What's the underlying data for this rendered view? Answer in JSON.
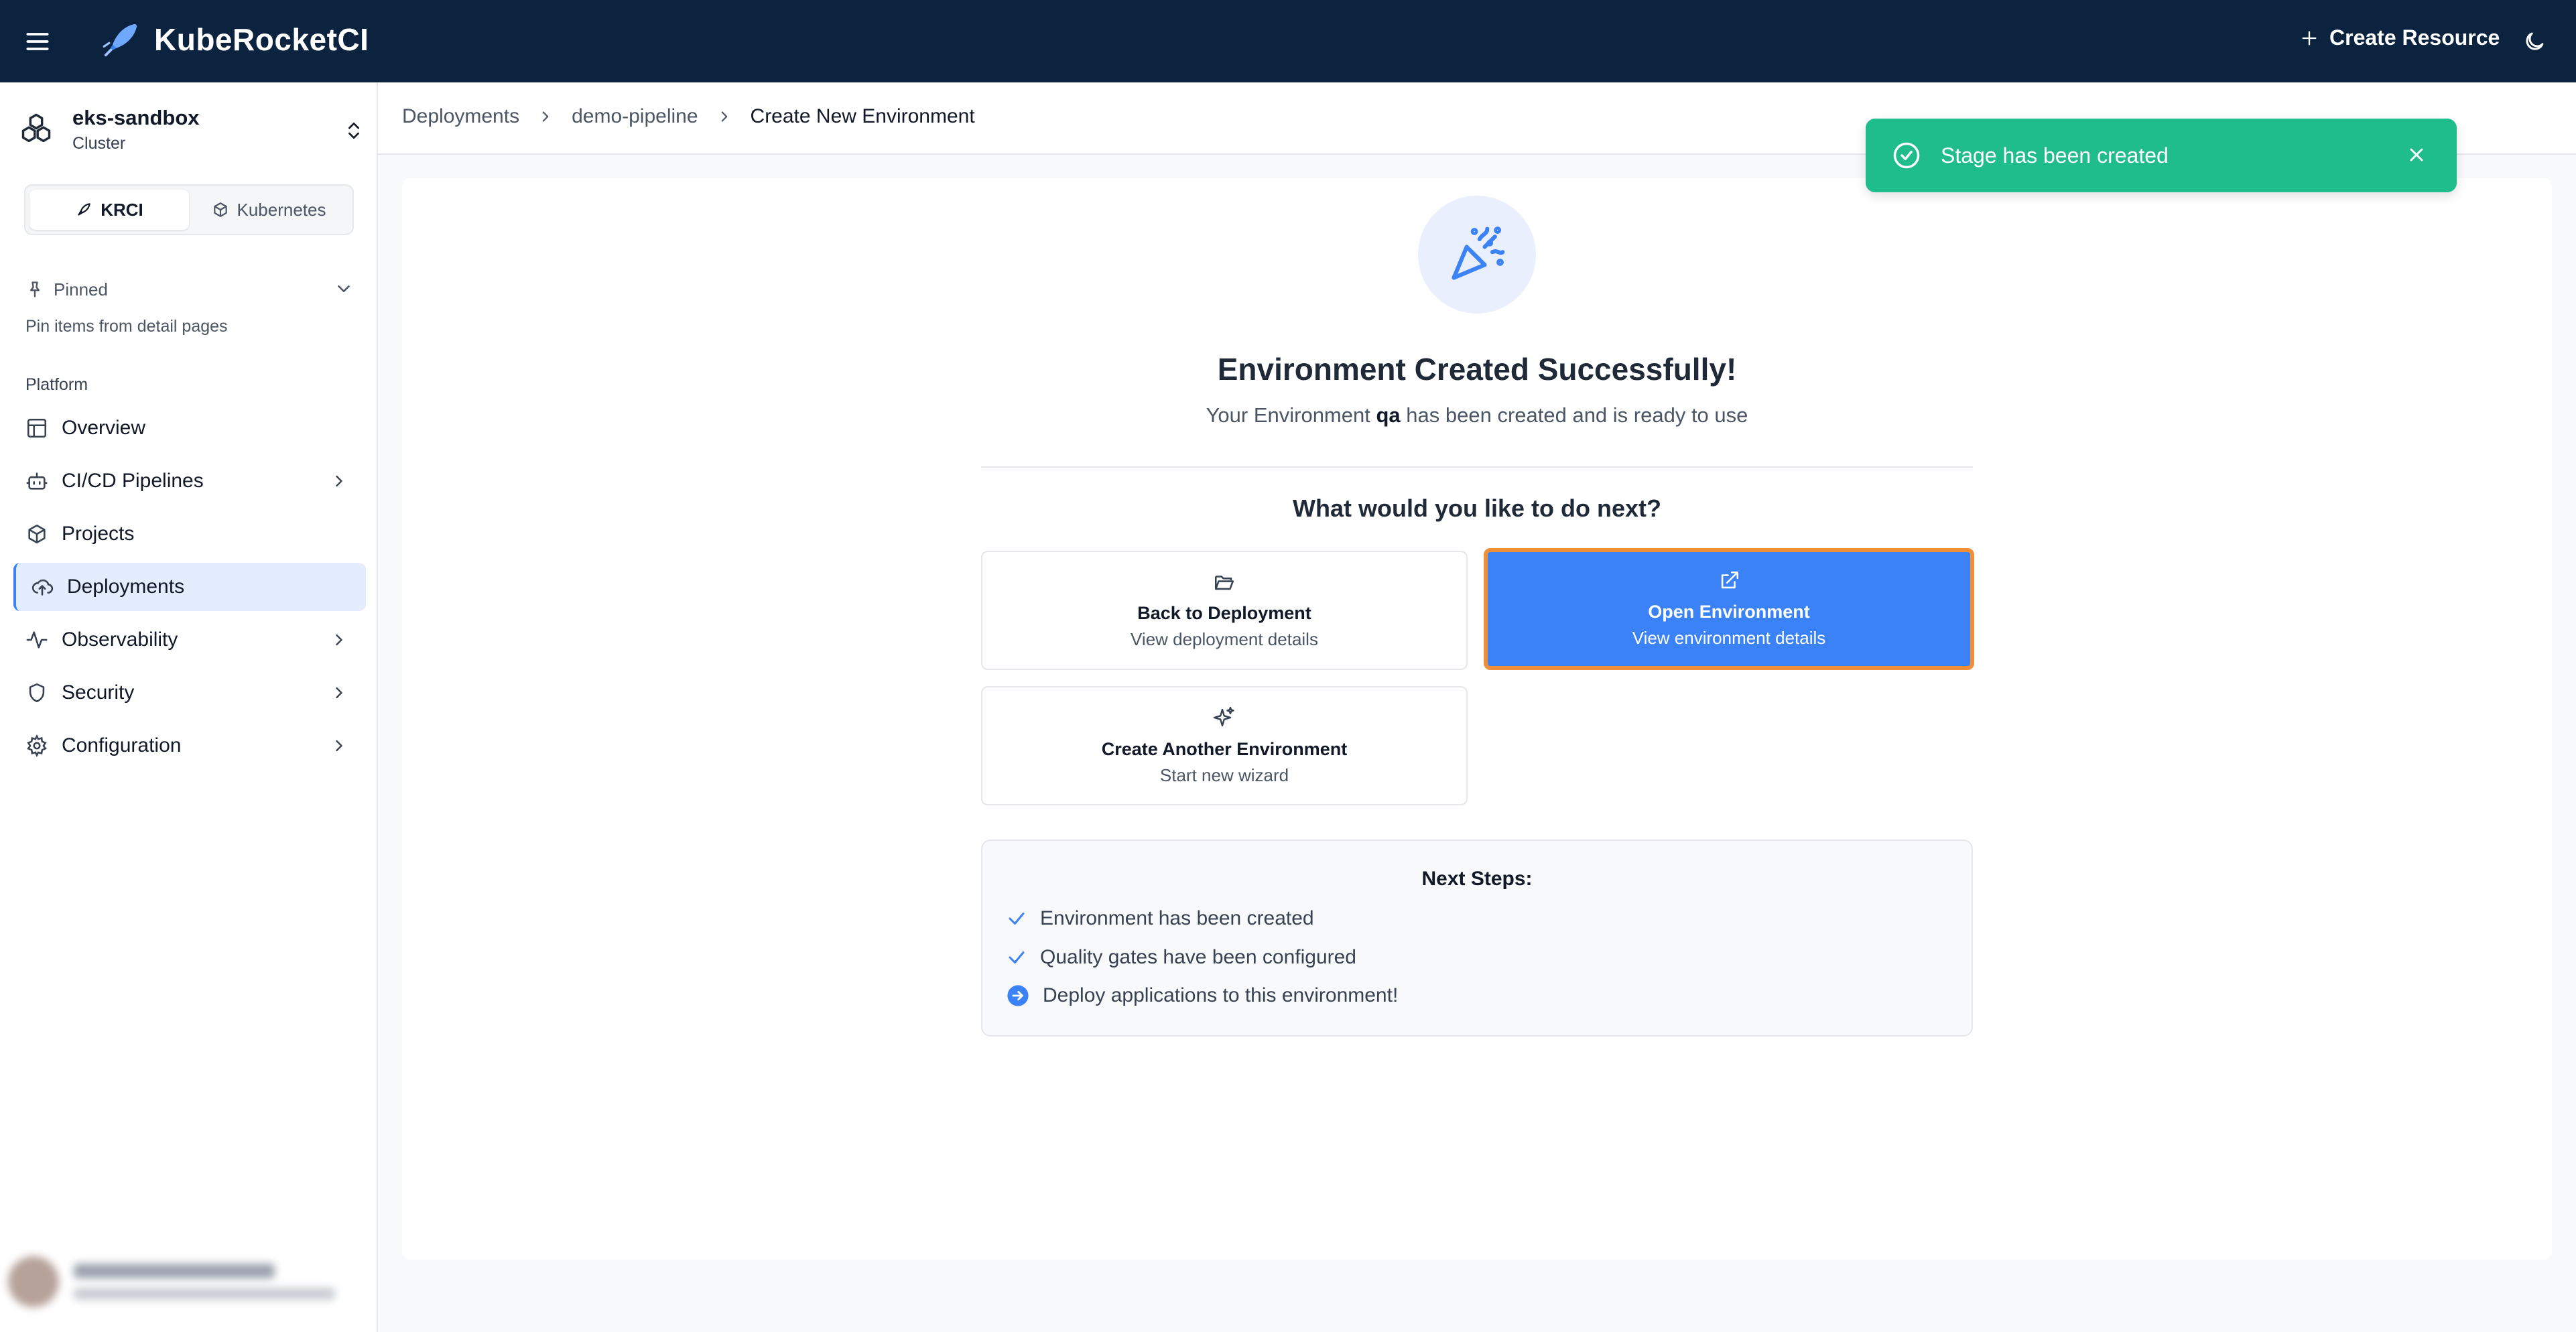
{
  "app": {
    "brand": "KubeRocketCI",
    "create_resource": "Create Resource"
  },
  "sidebar": {
    "cluster_name": "eks-sandbox",
    "cluster_type": "Cluster",
    "tabs": [
      {
        "label": "KRCI",
        "active": true
      },
      {
        "label": "Kubernetes",
        "active": false
      }
    ],
    "pinned_label": "Pinned",
    "pinned_hint": "Pin items from detail pages",
    "section_label": "Platform",
    "items": [
      {
        "label": "Overview",
        "icon": "overview-icon",
        "has_children": false,
        "active": false
      },
      {
        "label": "CI/CD Pipelines",
        "icon": "bot-icon",
        "has_children": true,
        "active": false
      },
      {
        "label": "Projects",
        "icon": "box-icon",
        "has_children": false,
        "active": false
      },
      {
        "label": "Deployments",
        "icon": "cloud-upload-icon",
        "has_children": false,
        "active": true
      },
      {
        "label": "Observability",
        "icon": "activity-icon",
        "has_children": true,
        "active": false
      },
      {
        "label": "Security",
        "icon": "shield-icon",
        "has_children": true,
        "active": false
      },
      {
        "label": "Configuration",
        "icon": "gear-icon",
        "has_children": true,
        "active": false
      }
    ]
  },
  "breadcrumbs": [
    "Deployments",
    "demo-pipeline",
    "Create New Environment"
  ],
  "toast": {
    "message": "Stage has been created",
    "color": "#1fbd8a"
  },
  "success": {
    "title": "Environment Created Successfully!",
    "subtitle_prefix": "Your Environment ",
    "env_name": "qa",
    "subtitle_suffix": " has been created and is ready to use",
    "next_question": "What would you like to do next?"
  },
  "actions": {
    "back": {
      "label": "Back to Deployment",
      "desc": "View deployment details"
    },
    "open": {
      "label": "Open Environment",
      "desc": "View environment details"
    },
    "another": {
      "label": "Create Another Environment",
      "desc": "Start new wizard"
    }
  },
  "next_steps": {
    "title": "Next Steps:",
    "items": [
      {
        "text": "Environment has been created",
        "status": "done"
      },
      {
        "text": "Quality gates have been configured",
        "status": "done"
      },
      {
        "text": "Deploy applications to this environment!",
        "status": "next"
      }
    ]
  },
  "colors": {
    "header_bg": "#0c2340",
    "accent": "#3b82f6",
    "highlight_border": "#ef8f3a"
  }
}
